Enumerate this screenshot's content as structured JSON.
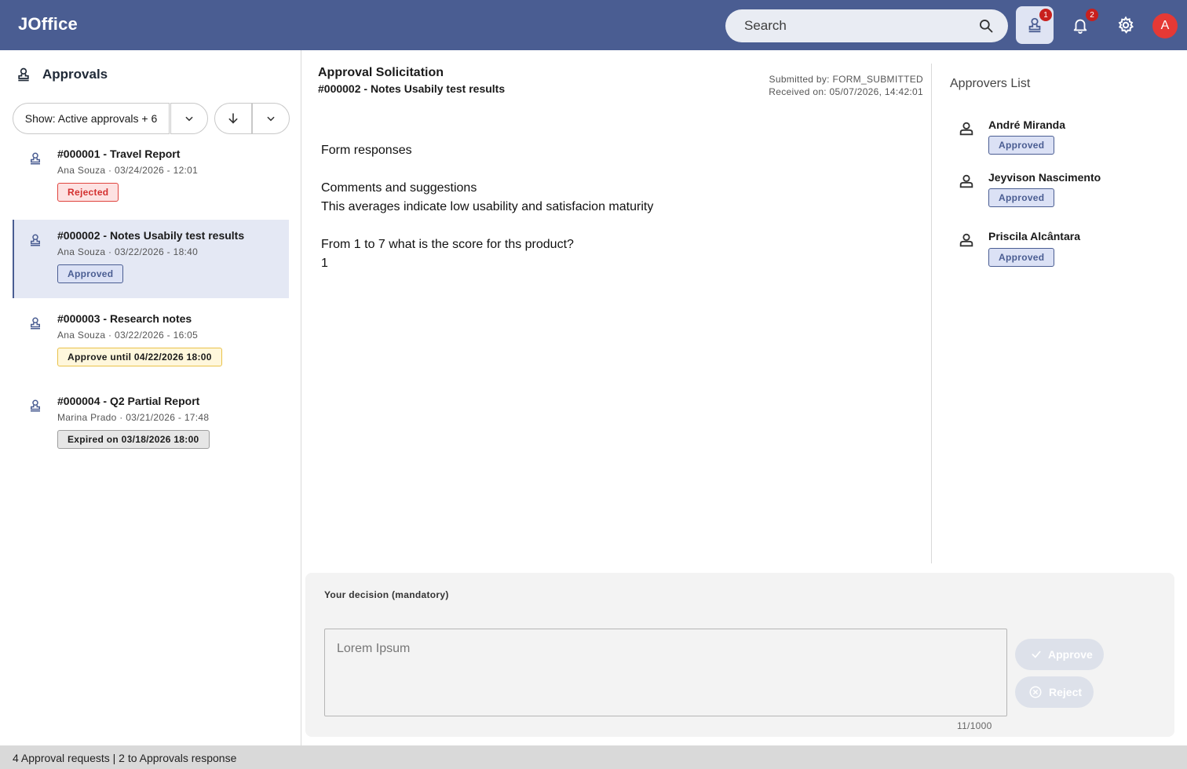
{
  "app": {
    "title": "JOffice"
  },
  "topbar": {
    "search_placeholder": "Search",
    "icons": [
      "search-icon",
      "approval-stamp-icon",
      "bell-icon",
      "gear-icon"
    ],
    "approvals_badge": "1",
    "notifications_badge": "2",
    "avatar_letter": "A",
    "colors": {
      "bar": "#4a5d92",
      "badge": "#c8201d",
      "avatar": "#e53935"
    }
  },
  "sidebar": {
    "title": "Approvals",
    "filter_label": "Show: Active approvals + 6",
    "items": [
      {
        "title": "#000001 - Travel Report",
        "meta": "Ana Souza · 03/24/2026 - 12:01",
        "status": "Rejected",
        "status_type": "rejected"
      },
      {
        "title": "#000002 - Notes Usabily test results",
        "meta": "Ana Souza · 03/22/2026 - 18:40",
        "status": "Approved",
        "status_type": "approved",
        "selected": true
      },
      {
        "title": "#000003 - Research notes",
        "meta": "Ana Souza · 03/22/2026 - 16:05",
        "status": "Approve until 04/22/2026 18:00",
        "status_type": "pending"
      },
      {
        "title": "#000004 - Q2 Partial Report",
        "meta": "Marina Prado · 03/21/2026 - 17:48",
        "status": "Expired on 03/18/2026 18:00",
        "status_type": "expired"
      }
    ]
  },
  "detail": {
    "title": "Approval Solicitation",
    "subtitle": "#000002 - Notes Usabily test results",
    "submitted_by": "Submitted by: FORM_SUBMITTED",
    "received_on": "Received on: 05/07/2026, 14:42:01",
    "section_title": "Form responses",
    "q1": "Comments and suggestions",
    "a1": "This averages indicate low usability and satisfacion maturity",
    "q2": "From 1 to 7 what is the score for ths product?",
    "a2": "1"
  },
  "approvers": {
    "title": "Approvers List",
    "list": [
      {
        "name": "André Miranda",
        "status": "Approved"
      },
      {
        "name": "Jeyvison Nascimento",
        "status": "Approved"
      },
      {
        "name": "Priscila Alcântara",
        "status": "Approved"
      }
    ]
  },
  "decision": {
    "label": "Your decision (mandatory)",
    "placeholder": "Lorem Ipsum",
    "counter": "11/1000",
    "approve_label": "Approve",
    "reject_label": "Reject"
  },
  "statusbar": {
    "text": "4 Approval requests | 2 to Approvals response"
  }
}
